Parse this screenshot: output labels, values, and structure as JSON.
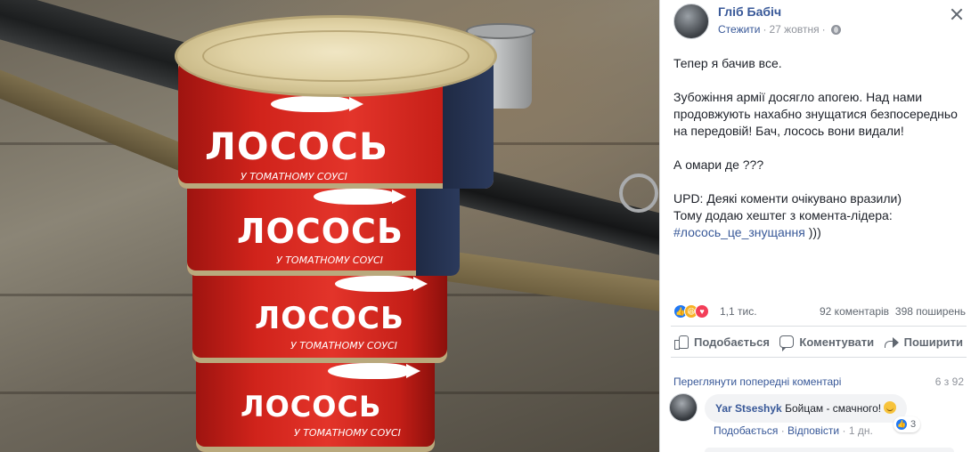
{
  "photo": {
    "can_brand": "ЛОСОСЬ",
    "can_subtitle": "У ТОМАТНОМУ СОУСІ"
  },
  "post": {
    "author": "Гліб Бабіч",
    "follow": "Стежити",
    "separator": "·",
    "date": "27 жовтня",
    "privacy_icon": "globe-icon",
    "paragraphs": {
      "p1": "Тепер я бачив все.",
      "p2": "Зубожіння армії досягло апогею. Над нами продовжують нахабно знущатися безпосередньо на передовій! Бач, лосось вони видали!",
      "p3": "А омари де ???",
      "p4a": "UPD: Деякі коменти очікувано вразили)",
      "p4b": "Тому додаю хештег з комента-лідера:",
      "hashtag": "#лосось_це_знущання",
      "hashtag_suffix": " )))"
    }
  },
  "stats": {
    "reactions": "1,1 тис.",
    "comments": "92 коментарів",
    "shares": "398 поширень",
    "reaction_icons": [
      "like-icon",
      "haha-icon",
      "love-icon"
    ]
  },
  "actions": {
    "like": "Подобається",
    "comment": "Коментувати",
    "share": "Поширити"
  },
  "comments": {
    "view_previous": "Переглянути попередні коментарі",
    "pager": "6 з 92",
    "items": [
      {
        "author": "Yar Stseshyk",
        "text": "Бойцам - смачного!",
        "reactions": "3",
        "like": "Подобається",
        "reply": "Відповісти",
        "time": "1 дн.",
        "dot": "·"
      }
    ]
  },
  "colors": {
    "link": "#385898",
    "muted": "#90949c",
    "can_red": "#d0231b"
  }
}
